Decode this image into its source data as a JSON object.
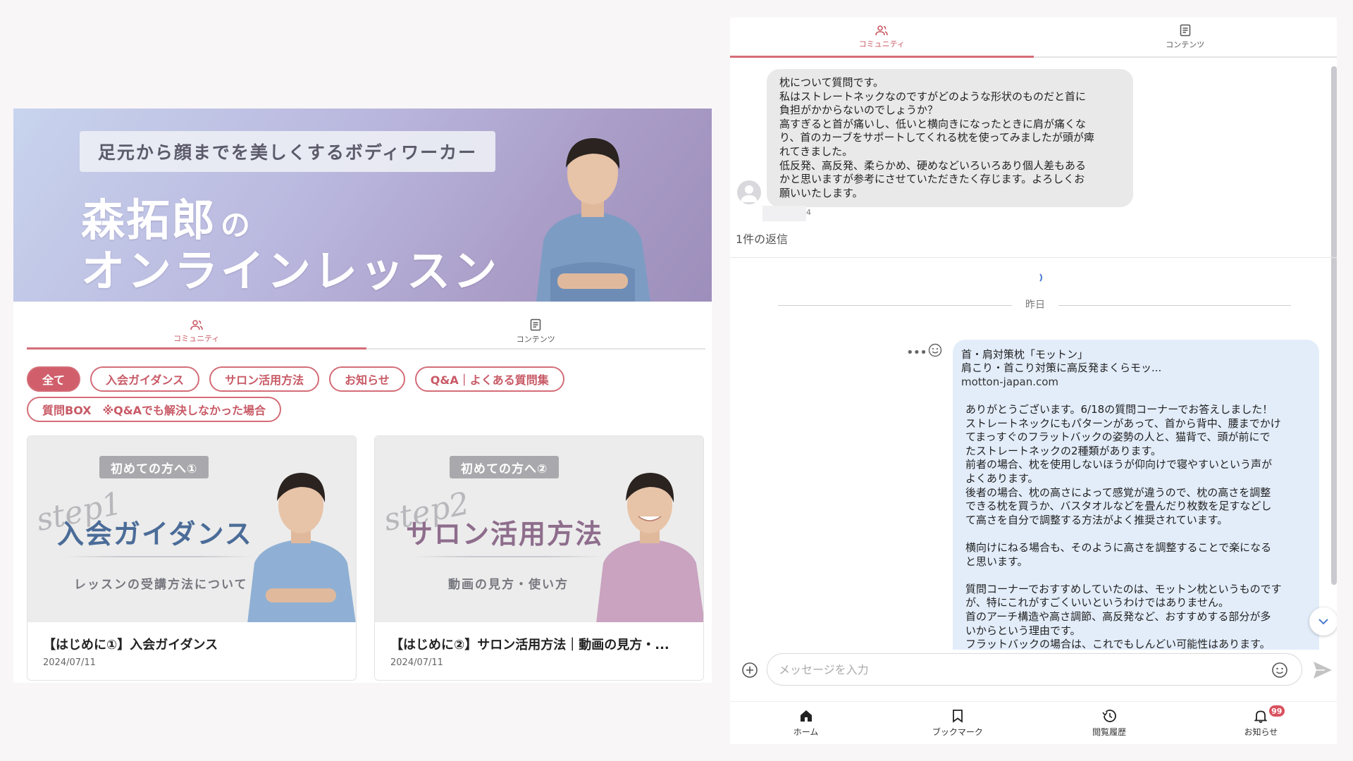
{
  "hero": {
    "subtitle": "足元から顔までを美しくするボディワーカー",
    "title_name": "森拓郎",
    "title_no": "の",
    "title_line2": "オンラインレッスン"
  },
  "left_tabs": [
    {
      "label": "コミュニティ",
      "icon": "community-icon",
      "active": true
    },
    {
      "label": "コンテンツ",
      "icon": "document-icon",
      "active": false
    }
  ],
  "chips_row1": [
    "全て",
    "入会ガイダンス",
    "サロン活用方法",
    "お知らせ",
    "Q&A｜よくある質問集"
  ],
  "chips_row2": [
    "質問BOX　※Q&Aでも解決しなかった場合"
  ],
  "cards": [
    {
      "tag": "初めての方へ①",
      "step": "step1",
      "title": "入会ガイダンス",
      "desc": "レッスンの受講方法について",
      "name": "【はじめに①】入会ガイダンス",
      "date": "2024/07/11",
      "title_color": "#4b6c98",
      "shirt_color": "#8fb0d4"
    },
    {
      "tag": "初めての方へ②",
      "step": "step2",
      "title": "サロン活用方法",
      "desc": "動画の見方・使い方",
      "name": "【はじめに②】サロン活用方法｜動画の見方・...",
      "date": "2024/07/11",
      "title_color": "#8e6d8c",
      "shirt_color": "#c9a3c0"
    }
  ],
  "right_tabs": [
    {
      "label": "コミュニティ",
      "icon": "community-icon",
      "active": true
    },
    {
      "label": "コンテンツ",
      "icon": "document-icon",
      "active": false
    }
  ],
  "question": {
    "text": "枕について質問です。\n私はストレートネックなのですがどのような形状のものだと首に\n負担がかからないのでしょうか？\n高すぎると首が痛いし、低いと横向きになったときに肩が痛くな\nり、首のカーブをサポートしてくれる枕を使ってみましたが頭が痺\nれてきました。\n低反発、高反発、柔らかめ、硬めなどいろいろあり個人差もある\nかと思いますが参考にさせていただきたく存じます。よろしくお\n願いいたします。",
    "time_suffix": "4",
    "reply_count": "1件の返信"
  },
  "date_separator": "昨日",
  "answer": {
    "link_title": "首・肩対策枕「モットン」",
    "link_desc": "肩こり・首こり対策に高反発まくらモッ...",
    "link_domain": "motton-japan.com",
    "text": "ありがとうございます。6/18の質問コーナーでお答えしました！\nストレートネックにもパターンがあって、首から背中、腰までかけ\nてまっすぐのフラットバックの姿勢の人と、猫背で、頭が前にで\nたストレートネックの2種類があります。\n前者の場合、枕を使用しないほうが仰向けで寝やすいという声が\nよくあります。\n後者の場合、枕の高さによって感覚が違うので、枕の高さを調整\nできる枕を買うか、バスタオルなどを畳んだり枚数を足すなどし\nて高さを自分で調整する方法がよく推奨されています。\n\n横向けにねる場合も、そのように高さを調整することで楽になる\nと思います。\n\n質問コーナーでおすすめしていたのは、モットン枕というものです\nが、特にこれがすごくいいというわけではありません。\n首のアーチ構造や高さ調節、高反発など、おすすめする部分が多\nいからという理由です。\nフラットバックの場合は、これでもしんどい可能性はあります。"
  },
  "input": {
    "placeholder": "メッセージを入力"
  },
  "bottom_nav": [
    {
      "label": "ホーム",
      "icon": "home-icon"
    },
    {
      "label": "ブックマーク",
      "icon": "bookmark-icon"
    },
    {
      "label": "閲覧履歴",
      "icon": "history-icon"
    },
    {
      "label": "お知らせ",
      "icon": "bell-icon",
      "badge": "99"
    }
  ],
  "colors": {
    "accent": "#d05f6b",
    "bubble_in": "#e9e9ea",
    "bubble_out": "#e3edfa"
  }
}
